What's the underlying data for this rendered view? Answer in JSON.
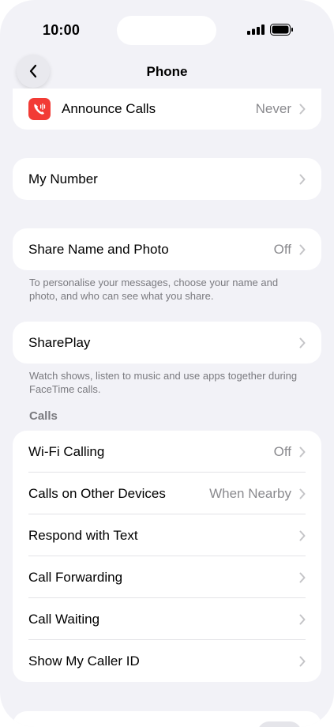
{
  "status": {
    "time": "10:00"
  },
  "nav": {
    "title": "Phone"
  },
  "announce": {
    "label": "Announce Calls",
    "value": "Never"
  },
  "my_number": {
    "label": "My Number"
  },
  "share": {
    "label": "Share Name and Photo",
    "value": "Off",
    "footnote": "To personalise your messages, choose your name and photo, and who can see what you share."
  },
  "shareplay": {
    "label": "SharePlay",
    "footnote": "Watch shows, listen to music and use apps together during FaceTime calls."
  },
  "calls": {
    "header": "Calls",
    "rows": [
      {
        "label": "Wi-Fi Calling",
        "value": "Off"
      },
      {
        "label": "Calls on Other Devices",
        "value": "When Nearby"
      },
      {
        "label": "Respond with Text",
        "value": ""
      },
      {
        "label": "Call Forwarding",
        "value": ""
      },
      {
        "label": "Call Waiting",
        "value": ""
      },
      {
        "label": "Show My Caller ID",
        "value": ""
      }
    ]
  },
  "colors": {
    "accent_red": "#f23b35",
    "background": "#f2f2f7",
    "secondary_text": "#8a8a8e"
  }
}
